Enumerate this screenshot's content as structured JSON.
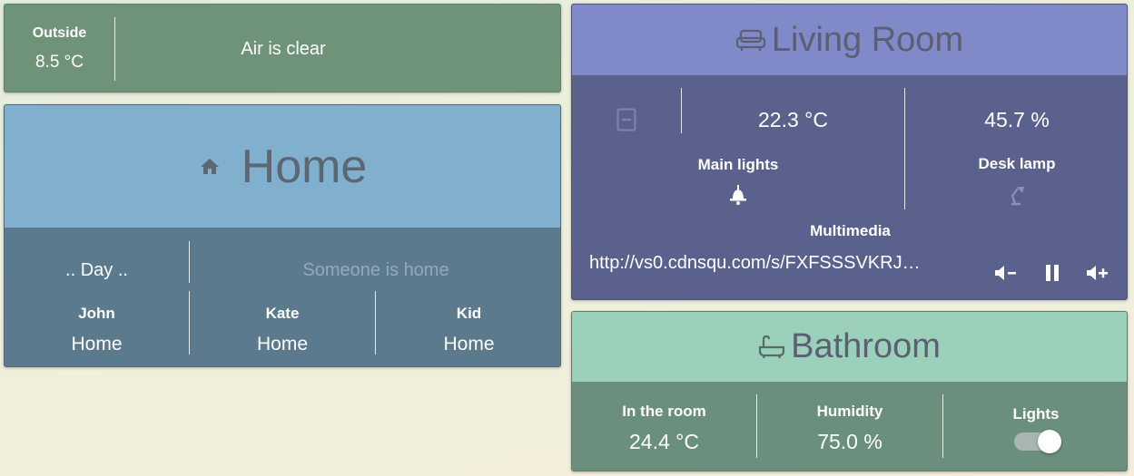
{
  "outside": {
    "label": "Outside",
    "temperature": "8.5 °C",
    "air_quality": "Air is clear"
  },
  "home": {
    "title": "Home",
    "icon": "home-icon",
    "time_of_day": ".. Day ..",
    "presence": "Someone is home",
    "people": [
      {
        "name": "John",
        "status": "Home"
      },
      {
        "name": "Kate",
        "status": "Home"
      },
      {
        "name": "Kid",
        "status": "Home"
      }
    ]
  },
  "living_room": {
    "title": "Living Room",
    "icon": "sofa-icon",
    "door_icon": "door-icon",
    "temperature": "22.3 °C",
    "humidity": "45.7 %",
    "main_lights_label": "Main lights",
    "main_lights_icon": "ceiling-light-icon",
    "desk_lamp_label": "Desk lamp",
    "desk_lamp_icon": "desk-lamp-icon",
    "multimedia_label": "Multimedia",
    "media_url": "http://vs0.cdnsqu.com/s/FXFSSSVKRJ…",
    "controls": [
      "volume-down-icon",
      "pause-icon",
      "volume-up-icon"
    ]
  },
  "bathroom": {
    "title": "Bathroom",
    "icon": "bathtub-icon",
    "in_room_label": "In the room",
    "in_room_temp": "24.4 °C",
    "humidity_label": "Humidity",
    "humidity_value": "75.0 %",
    "lights_label": "Lights",
    "lights_on": true
  },
  "colors": {
    "outside_bg": "#6f9379",
    "home_header": "#80b0ce",
    "home_body": "#5c7a8e",
    "living_header": "#808ac9",
    "living_body": "#59618c",
    "bath_header": "#9bd1ba",
    "bath_body": "#6a907d"
  }
}
